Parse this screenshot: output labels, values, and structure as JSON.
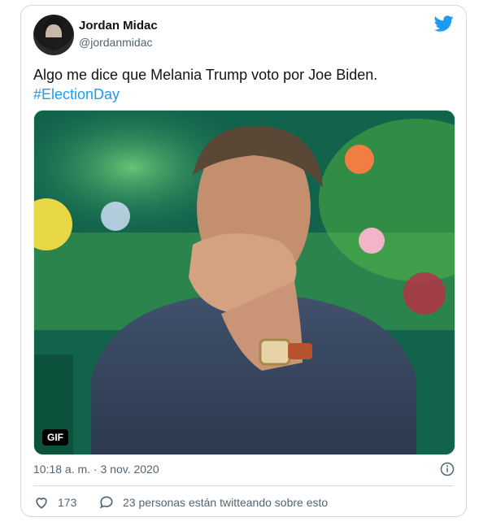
{
  "tweet": {
    "author_name": "Jordan Midac",
    "author_handle": "@jordanmidac",
    "text": "Algo me dice que Melania Trump voto por Joe Biden.",
    "hashtag": "#ElectionDay",
    "media_badge": "GIF",
    "timestamp": "10:18 a. m. · 3 nov. 2020",
    "like_count": "173",
    "conversation_text": "23 personas están twitteando sobre esto"
  },
  "colors": {
    "accent": "#1d9bf0",
    "secondary_text": "#536471",
    "border": "#cfd9de"
  },
  "icons": {
    "brand": "twitter-bird-icon",
    "info": "info-icon",
    "like": "heart-icon",
    "reply": "speech-bubble-icon"
  }
}
